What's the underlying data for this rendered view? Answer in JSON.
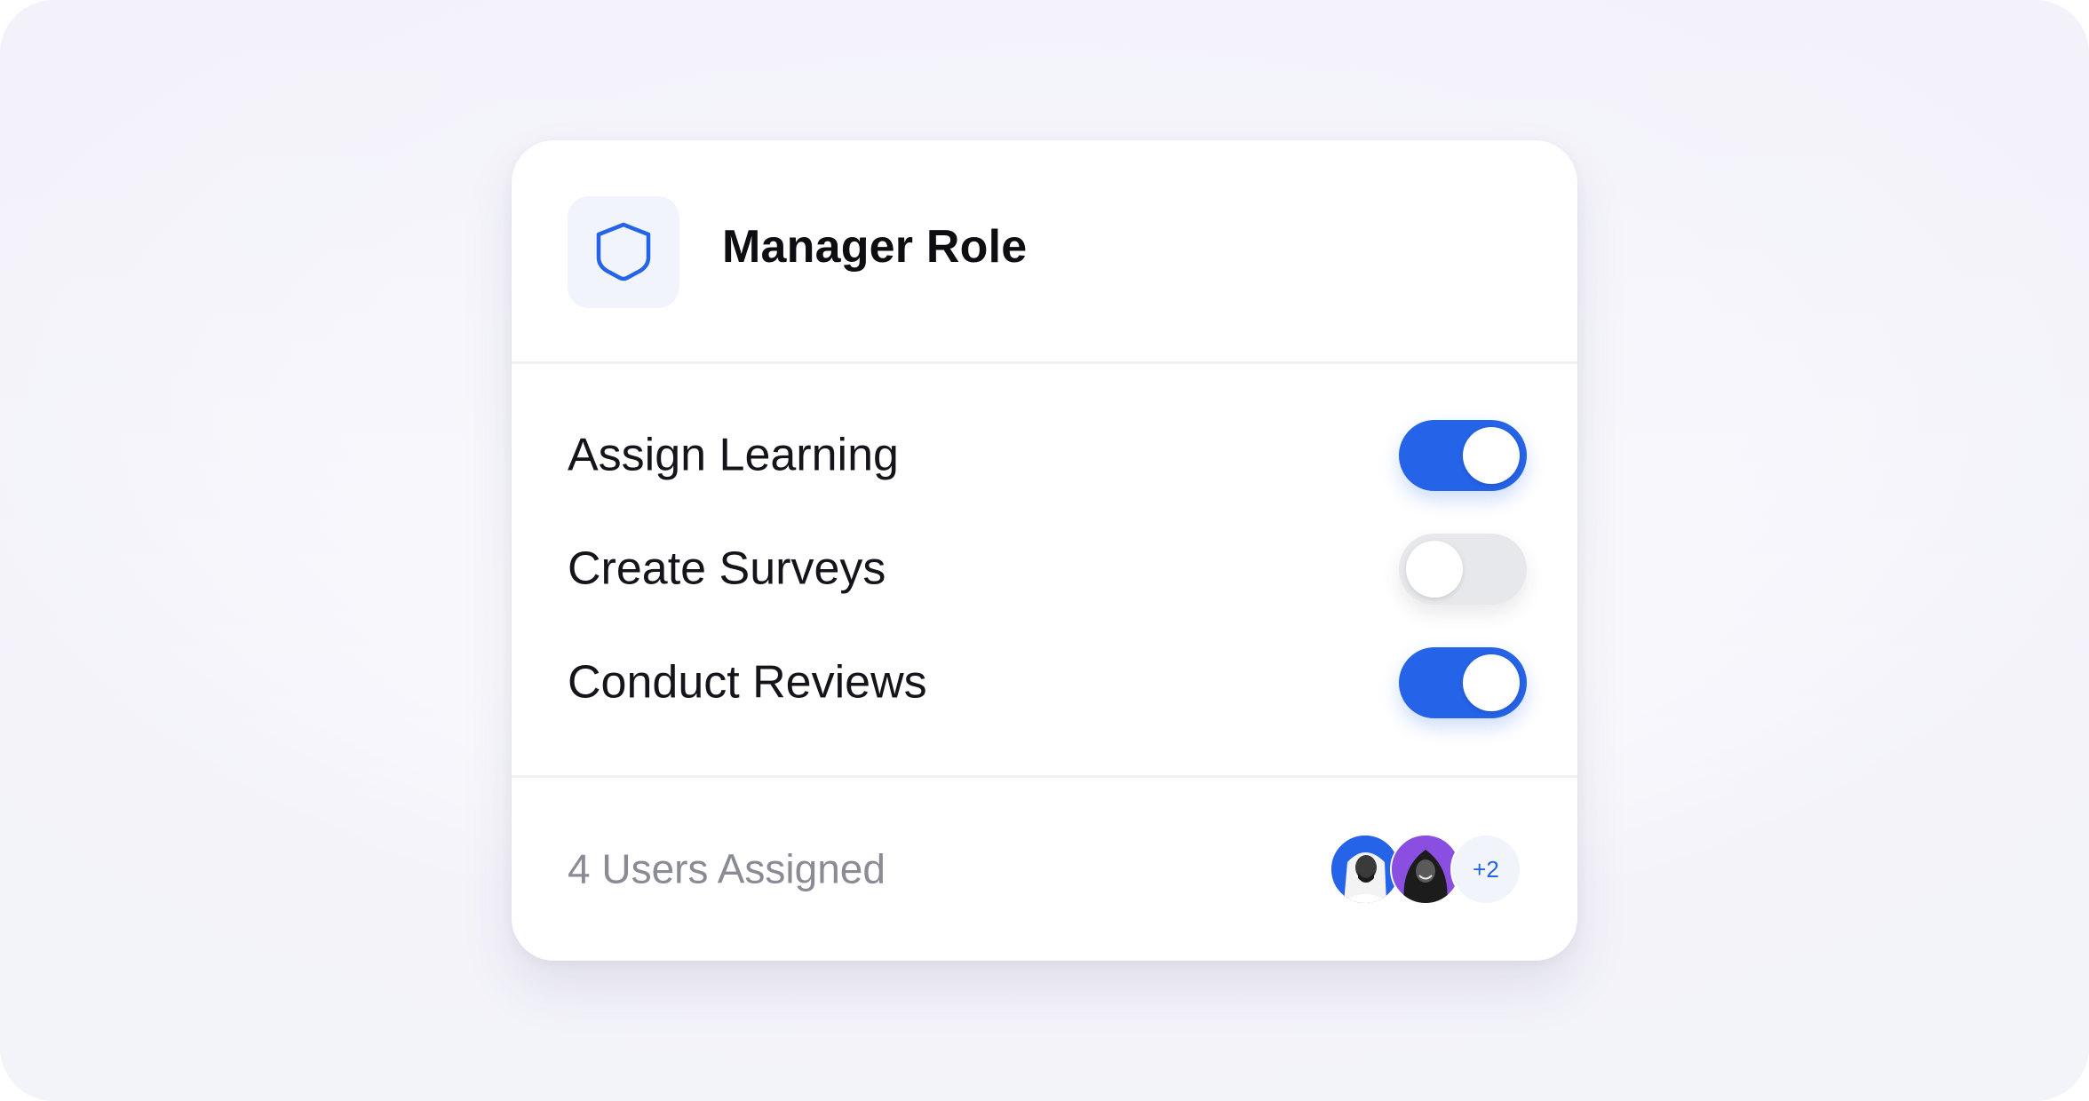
{
  "role": {
    "title": "Manager Role",
    "icon": "shield-icon"
  },
  "permissions": [
    {
      "label": "Assign Learning",
      "enabled": true
    },
    {
      "label": "Create Surveys",
      "enabled": false
    },
    {
      "label": "Conduct Reviews",
      "enabled": true
    }
  ],
  "footer": {
    "users_text": "4 Users Assigned",
    "more_count": "+2"
  },
  "colors": {
    "accent": "#2563e8",
    "toggle_off": "#e7e8eb",
    "avatar_2_bg": "#8a4fe0",
    "icon_tile_bg": "#f1f5fb"
  }
}
